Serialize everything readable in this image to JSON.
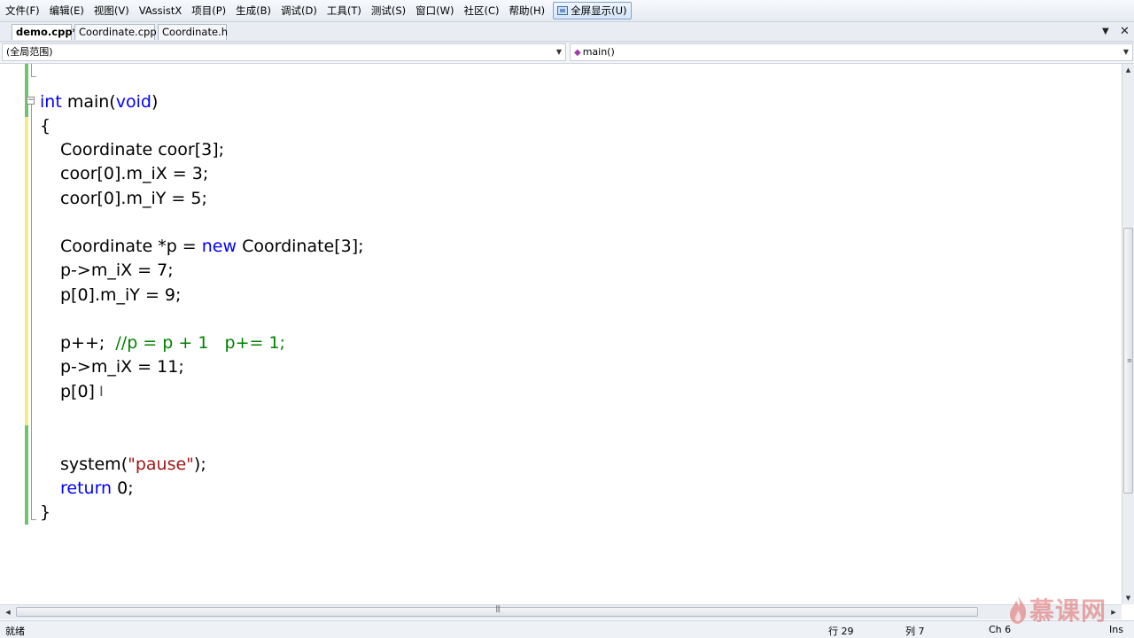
{
  "menu": [
    "文件(F)",
    "编辑(E)",
    "视图(V)",
    "VAssistX",
    "项目(P)",
    "生成(B)",
    "调试(D)",
    "工具(T)",
    "测试(S)",
    "窗口(W)",
    "社区(C)",
    "帮助(H)"
  ],
  "fullscreen_label": "全屏显示(U)",
  "tabs": [
    "demo.cpp*",
    "Coordinate.cpp",
    "Coordinate.h"
  ],
  "nav": {
    "scope": "(全局范围)",
    "function": "main()"
  },
  "code": {
    "l1_kw": "int",
    "l1_mid": " main(",
    "l1_kw2": "void",
    "l1_end": ")",
    "l2": "{",
    "l3": "Coordinate coor[3];",
    "l4": "coor[0].m_iX = 3;",
    "l5": "coor[0].m_iY = 5;",
    "l6_a": "Coordinate *p = ",
    "l6_kw": "new",
    "l6_b": " Coordinate[3];",
    "l7": "p->m_iX = 7;",
    "l8": "p[0].m_iY = 9;",
    "l9_code": "p++;  ",
    "l9_comment": "//p = p + 1   p+= 1;",
    "l10": "p->m_iX = 11;",
    "l11": "p[0]",
    "l12_a": "system(",
    "l12_str": "\"pause\"",
    "l12_b": ");",
    "l13_kw": "return",
    "l13_b": " 0;",
    "l14": "}"
  },
  "status": {
    "left": "就绪",
    "row": "行 29",
    "col": "列 7",
    "ch": "Ch 6",
    "mode": "Ins"
  },
  "watermark": "慕课网",
  "colors": {
    "keyword": "#0000ff",
    "comment": "#008000",
    "string": "#a31515",
    "changed_margin": "#6fc56c",
    "unsaved_margin": "#f5ea80"
  },
  "icons": {
    "fullscreen": "window-icon",
    "function": "method-icon",
    "close_tab": "close-icon",
    "tab_menu": "chevron-down-icon"
  }
}
